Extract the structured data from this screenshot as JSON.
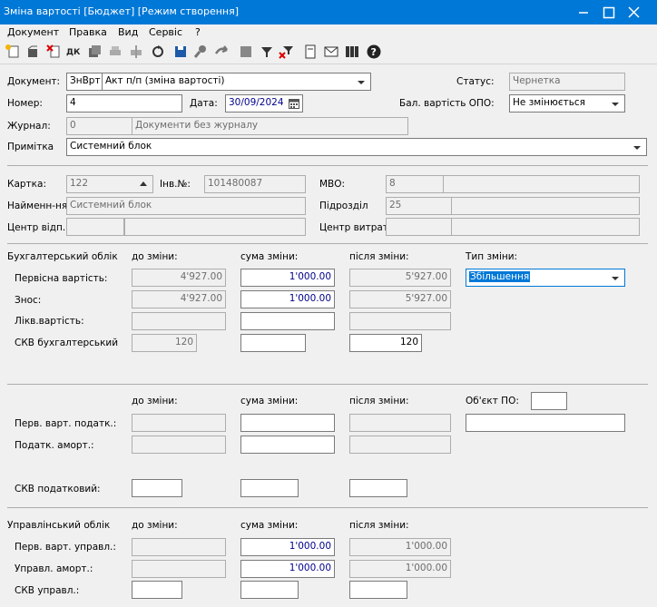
{
  "window": {
    "title": "Зміна вартості [Бюджет] [Режим створення]"
  },
  "menu": [
    "Документ",
    "Правка",
    "Вид",
    "Сервіс",
    "?"
  ],
  "toolbar": {
    "icons": [
      "new-doc-icon",
      "open-icon",
      "delete-icon",
      "dk-icon",
      "copy-icon",
      "print-disabled-icon",
      "export-disabled-icon",
      "refresh-icon",
      "save-icon",
      "key-icon",
      "forward-icon",
      "stop-icon",
      "filter-icon",
      "clear-filter-icon",
      "doc-icon",
      "mail-icon",
      "calc-icon",
      "help-icon"
    ],
    "dk_label": "ДК"
  },
  "doc": {
    "document_label": "Документ:",
    "document_code": "ЗнВрт",
    "document_name": "Акт п/п (зміна вартості)",
    "status_label": "Статус:",
    "status_value": "Чернетка",
    "number_label": "Номер:",
    "number_value": "4",
    "date_label": "Дата:",
    "date_value": "30/09/2024",
    "balance_label": "Бал. вартість ОПО:",
    "balance_value": "Не змінюється",
    "journal_label": "Журнал:",
    "journal_code": "0",
    "journal_name": "Документи без журналу",
    "note_label": "Примітка",
    "note_value": "Системний блок"
  },
  "card": {
    "card_label": "Картка:",
    "card_value": "122",
    "inv_label": "Інв.№:",
    "inv_value": "101480087",
    "mvo_label": "МВО:",
    "mvo_code": "8",
    "name_label": "Найменн-ня",
    "name_value": "Системний блок",
    "dept_label": "Підрозділ",
    "dept_code": "25",
    "center_resp_label": "Центр відп.",
    "center_cost_label": "Центр витрат"
  },
  "accounting": {
    "section_label": "Бухгалтерський облік",
    "col_before": "до зміни:",
    "col_sum": "сума зміни:",
    "col_after": "після зміни:",
    "change_type_label": "Тип зміни:",
    "change_type_value": "Збільшення",
    "rows": [
      {
        "label": "Первісна вартість:",
        "before": "4'927.00",
        "sum": "1'000.00",
        "after": "5'927.00"
      },
      {
        "label": "Знос:",
        "before": "4'927.00",
        "sum": "1'000.00",
        "after": "5'927.00"
      },
      {
        "label": "Лікв.вартість:",
        "before": "",
        "sum": "",
        "after": ""
      },
      {
        "label": "СКВ бухгалтерський",
        "before": "120",
        "sum": "",
        "after": "120"
      }
    ]
  },
  "tax": {
    "col_before": "до зміни:",
    "col_sum": "сума зміни:",
    "col_after": "після зміни:",
    "object_label": "Об'єкт ПО:",
    "rows": [
      {
        "label": "Перв. варт. податк.:"
      },
      {
        "label": "Податк. аморт.:"
      },
      {
        "label": "СКВ податковий:"
      }
    ]
  },
  "management": {
    "section_label": "Управлінський облік",
    "col_before": "до зміни:",
    "col_sum": "сума зміни:",
    "col_after": "після зміни:",
    "rows": [
      {
        "label": "Перв. варт. управл.:",
        "before": "",
        "sum": "1'000.00",
        "after": "1'000.00"
      },
      {
        "label": "Управл. аморт.:",
        "before": "",
        "sum": "1'000.00",
        "after": "1'000.00"
      },
      {
        "label": "СКВ управл.:",
        "before": "",
        "sum": "",
        "after": ""
      }
    ]
  }
}
